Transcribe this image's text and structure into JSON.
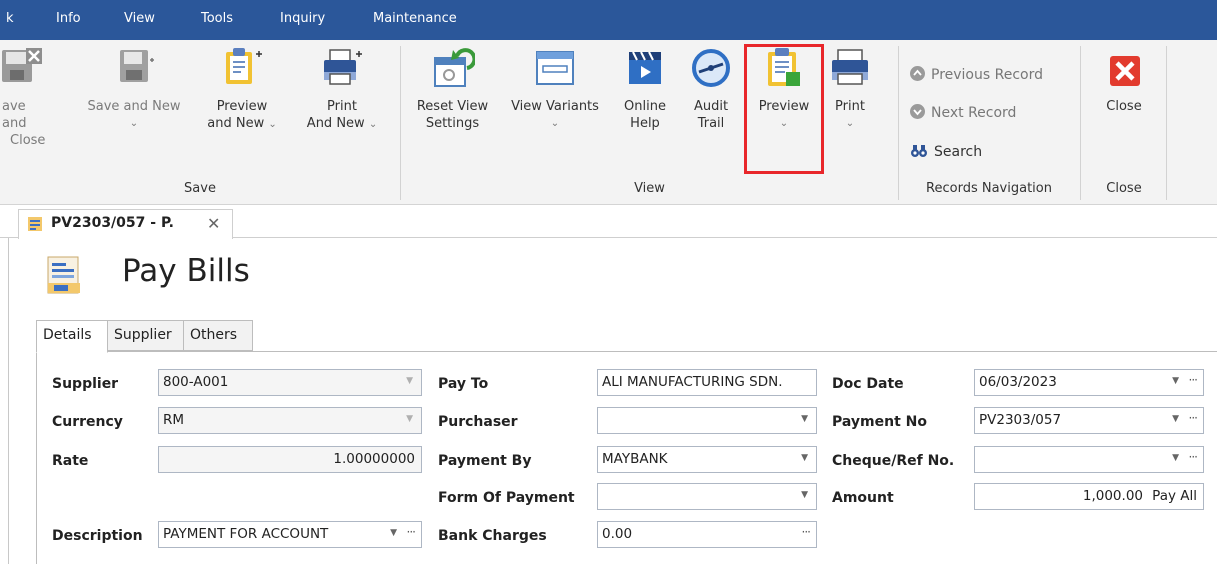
{
  "menu": {
    "items": [
      "k",
      "Info",
      "View",
      "Tools",
      "Inquiry",
      "Maintenance"
    ]
  },
  "ribbon": {
    "save_group": {
      "label": "Save",
      "save_close": [
        "ave and",
        "Close"
      ],
      "save_new": [
        "Save and New"
      ],
      "preview_new": [
        "Preview",
        "and New"
      ],
      "print_new": [
        "Print",
        "And New"
      ]
    },
    "view_group": {
      "label": "View",
      "reset": [
        "Reset View",
        "Settings"
      ],
      "variants": [
        "View Variants"
      ],
      "online_help": [
        "Online",
        "Help"
      ],
      "audit_trail": [
        "Audit",
        "Trail"
      ],
      "preview": "Preview",
      "print": "Print"
    },
    "nav_group": {
      "label": "Records Navigation",
      "previous": "Previous Record",
      "next": "Next Record",
      "search": "Search"
    },
    "close_group": {
      "label": "Close",
      "close": "Close"
    }
  },
  "doc_tab": {
    "title": "PV2303/057 - P."
  },
  "page": {
    "title": "Pay Bills",
    "tabs": [
      "Details",
      "Supplier",
      "Others"
    ]
  },
  "form": {
    "supplier": {
      "label": "Supplier",
      "value": "800-A001"
    },
    "currency": {
      "label": "Currency",
      "value": "RM"
    },
    "rate": {
      "label": "Rate",
      "value": "1.00000000"
    },
    "description": {
      "label": "Description",
      "value": "PAYMENT FOR ACCOUNT"
    },
    "pay_to": {
      "label": "Pay To",
      "value": "ALI MANUFACTURING SDN."
    },
    "purchaser": {
      "label": "Purchaser",
      "value": ""
    },
    "payment_by": {
      "label": "Payment By",
      "value": "MAYBANK"
    },
    "form_of_payment": {
      "label": "Form Of Payment",
      "value": ""
    },
    "bank_charges": {
      "label": "Bank Charges",
      "value": "0.00"
    },
    "doc_date": {
      "label": "Doc Date",
      "value": "06/03/2023"
    },
    "payment_no": {
      "label": "Payment No",
      "value": "PV2303/057"
    },
    "cheque_ref": {
      "label": "Cheque/Ref No.",
      "value": ""
    },
    "amount": {
      "label": "Amount",
      "value": "1,000.00",
      "action": "Pay All"
    }
  },
  "colors": {
    "menubar": "#2b579a",
    "highlight": "#e8262a",
    "close_icon": "#e23b2e"
  }
}
